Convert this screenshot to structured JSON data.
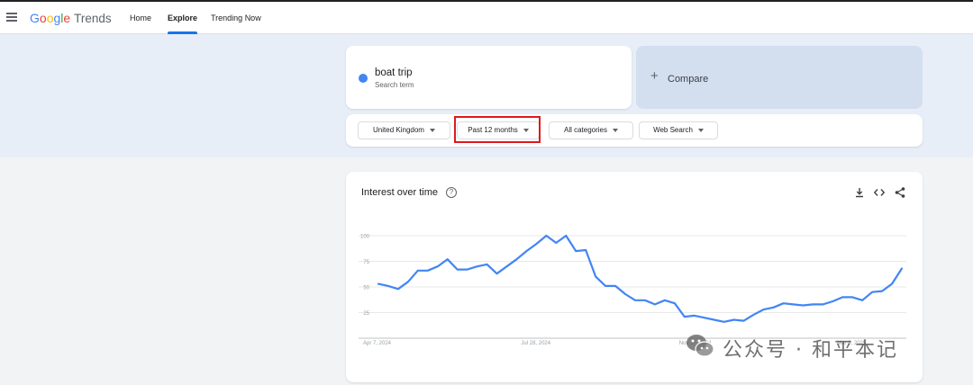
{
  "header": {
    "logo": {
      "google": [
        "G",
        "o",
        "o",
        "g",
        "l",
        "e"
      ],
      "trends": "Trends"
    },
    "nav": [
      {
        "label": "Home",
        "active": false
      },
      {
        "label": "Explore",
        "active": true
      },
      {
        "label": "Trending Now",
        "active": false
      }
    ]
  },
  "search": {
    "term": "boat trip",
    "term_type": "Search term",
    "term_color": "#4285f4",
    "compare_label": "Compare",
    "compare_icon": "plus-icon"
  },
  "filters": {
    "region": "United Kingdom",
    "time_range": "Past 12 months",
    "category": "All categories",
    "search_type": "Web Search"
  },
  "chart": {
    "title": "Interest over time",
    "help_icon": "help-circle-icon",
    "tools": [
      "download-icon",
      "embed-code-icon",
      "share-icon"
    ]
  },
  "chart_data": {
    "type": "line",
    "series": [
      {
        "values": [
          53,
          51,
          48,
          55,
          66,
          66,
          70,
          77,
          67,
          67,
          70,
          72,
          63,
          70,
          77,
          85,
          92,
          100,
          93,
          100,
          85,
          86,
          60,
          51,
          51,
          43,
          37,
          37,
          33,
          37,
          34,
          21,
          22,
          20,
          18,
          16,
          18,
          17,
          23,
          28,
          30,
          34,
          33,
          32,
          33,
          33,
          36,
          40,
          40,
          37,
          45,
          46,
          53,
          68
        ]
      }
    ],
    "yticks": [
      25,
      50,
      75,
      100
    ],
    "xtick_labels": [
      "Apr 7, 2024",
      "Jul 28, 2024",
      "Nov 17, 2024",
      "Mar 9, 2025"
    ],
    "xtick_indices": [
      0,
      16,
      32,
      48
    ],
    "ylim": [
      0,
      100
    ],
    "line_color": "#4285f4",
    "grid": true
  },
  "watermark": {
    "text": "公众号 · 和平本记",
    "icon": "wechat-icon"
  }
}
